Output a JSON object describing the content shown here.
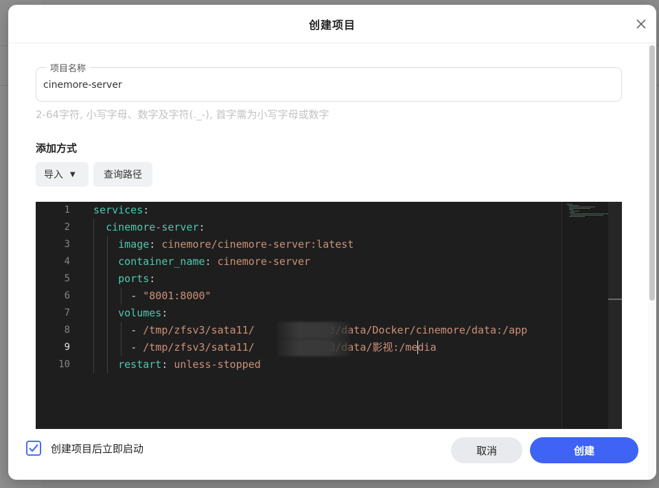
{
  "dialog": {
    "title": "创建项目",
    "close_icon": "close-icon"
  },
  "project_name": {
    "legend": "项目名称",
    "value": "cinemore-server",
    "hint": "2-64字符, 小写字母、数字及字符(._-), 首字需为小写字母或数字"
  },
  "add_method": {
    "label": "添加方式",
    "import_button": "导入",
    "import_caret_icon": "caret-down-icon",
    "query_path_button": "查询路径"
  },
  "editor": {
    "active_line": 9,
    "line_numbers": [
      "1",
      "2",
      "3",
      "4",
      "5",
      "6",
      "7",
      "8",
      "9",
      "10"
    ],
    "lines": [
      {
        "pre": "",
        "key": "services",
        "rest": ":"
      },
      {
        "pre": "  ",
        "key": "cinemore-server",
        "rest": ":"
      },
      {
        "pre": "    ",
        "key": "image",
        "rest": ": ",
        "val": "cinemore/cinemore-server:latest"
      },
      {
        "pre": "    ",
        "key": "container_name",
        "rest": ": ",
        "val": "cinemore-server"
      },
      {
        "pre": "    ",
        "key": "ports",
        "rest": ":"
      },
      {
        "pre": "      ",
        "dash": "- ",
        "val": "\"8001:8000\""
      },
      {
        "pre": "    ",
        "key": "volumes",
        "rest": ":"
      },
      {
        "pre": "      ",
        "dash": "- ",
        "val": "/tmp/zfsv3/sata11/            3/data/Docker/cinemore/data:/app"
      },
      {
        "pre": "      ",
        "dash": "- ",
        "val": "/tmp/zfsv3/sata11/            3/data/影视:/media"
      },
      {
        "pre": "    ",
        "key": "restart",
        "rest": ": ",
        "val": "unless-stopped"
      }
    ]
  },
  "footer": {
    "auto_start_label": "创建项目后立即启动",
    "auto_start_checked": true,
    "cancel_button": "取消",
    "create_button": "创建"
  },
  "colors": {
    "primary": "#3e63f5",
    "editor_bg": "#1e1e1e",
    "yaml_key": "#4ec9b0",
    "yaml_value": "#ce9178"
  }
}
